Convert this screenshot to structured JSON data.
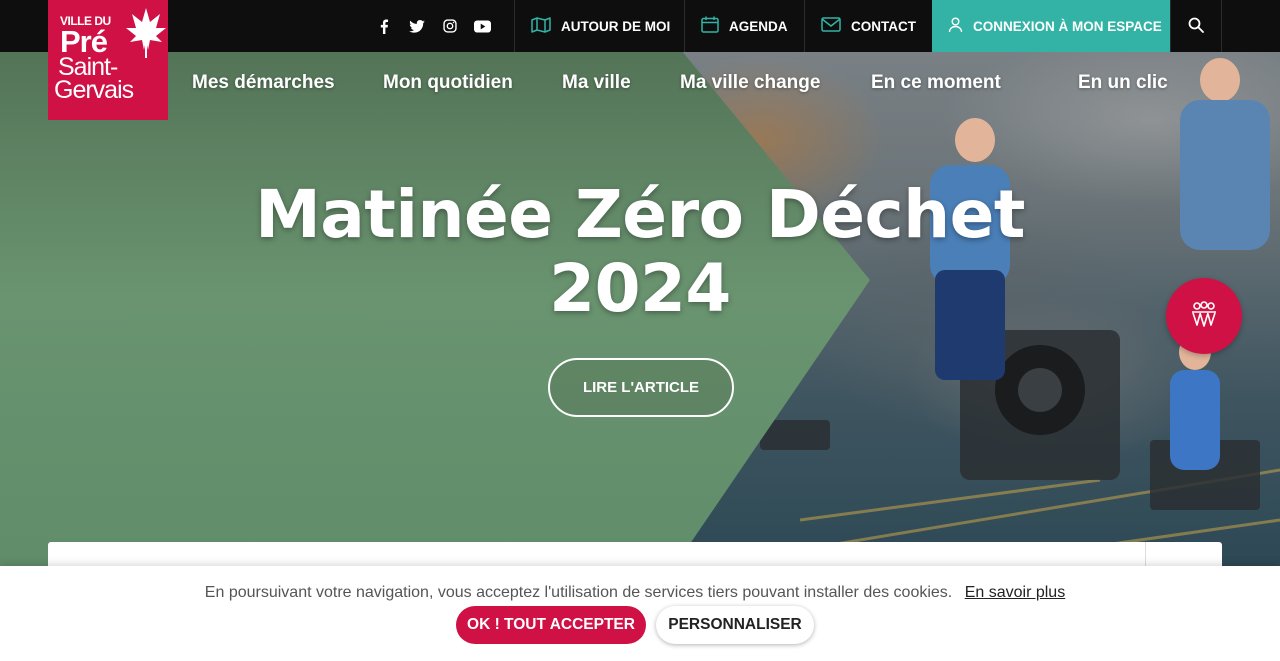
{
  "brand": {
    "line1": "VILLE DU",
    "line2": "Pré",
    "line3": "Saint-",
    "line4": "Gervais",
    "color": "#d01145"
  },
  "topbar": {
    "social": [
      "facebook-icon",
      "twitter-icon",
      "instagram-icon",
      "youtube-icon"
    ],
    "autour_label": "AUTOUR DE MOI",
    "agenda_label": "AGENDA",
    "contact_label": "CONTACT",
    "connexion_label": "CONNEXION À MON ESPACE",
    "connexion_color": "#33b3a6"
  },
  "nav": {
    "items": [
      "Mes démarches",
      "Mon quotidien",
      "Ma ville",
      "Ma ville change",
      "En ce moment",
      "En un clic"
    ]
  },
  "hero": {
    "title_line1": "Matinée Zéro Déchet",
    "title_line2": "2024",
    "button_label": "LIRE L'ARTICLE"
  },
  "cookie": {
    "message": "En poursuivant votre navigation, vous acceptez l'utilisation de services tiers pouvant installer des cookies.",
    "more_link": "En savoir plus",
    "accept_label": "OK ! TOUT ACCEPTER",
    "customize_label": "PERSONNALISER"
  }
}
